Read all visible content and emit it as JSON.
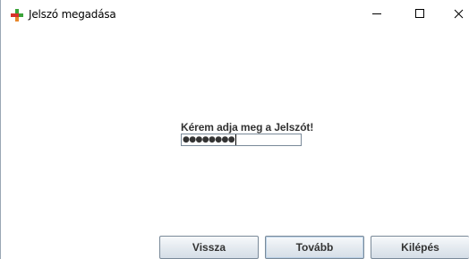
{
  "window": {
    "title": "Jelszó megadása",
    "icon": "green-red-plus-icon",
    "controls": {
      "minimize": "minimize-icon",
      "maximize": "maximize-icon",
      "close": "close-icon"
    }
  },
  "form": {
    "prompt": "Kérem adja meg a Jelszót!",
    "password_masked": "●●●●●●●●"
  },
  "buttons": {
    "back_label": "Vissza",
    "next_label": "Tovább",
    "exit_label": "Kilépés"
  },
  "colors": {
    "button_gradient_top": "#f7f9fb",
    "button_gradient_bottom": "#d5dee7",
    "button_border": "#7a8a99",
    "text": "#333333"
  }
}
